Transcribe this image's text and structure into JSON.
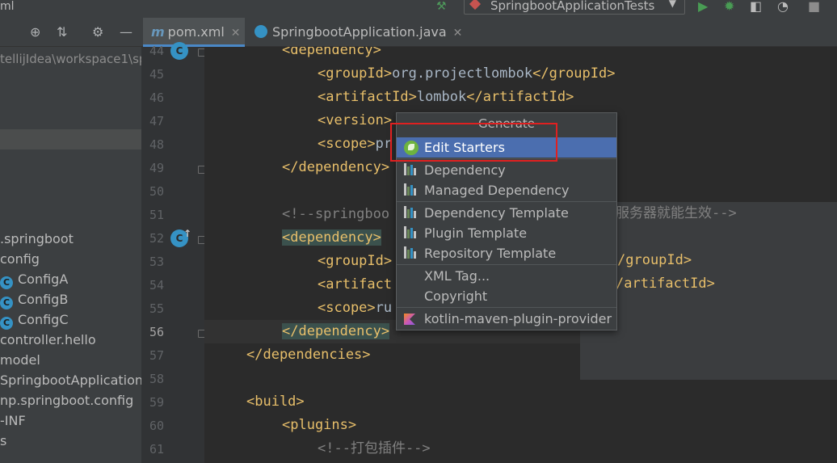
{
  "window": {
    "title_fragment": "ml"
  },
  "run_config": {
    "label": "SpringbootApplicationTests"
  },
  "project_panel": {
    "path": "tellijIdea\\workspace1\\sp",
    "items": [
      {
        "label": ".springboot",
        "icon": ""
      },
      {
        "label": "config",
        "icon": ""
      },
      {
        "label": "ConfigA",
        "icon": "class-icon"
      },
      {
        "label": "ConfigB",
        "icon": "class-icon"
      },
      {
        "label": "ConfigC",
        "icon": "class-icon"
      },
      {
        "label": "controller.hello",
        "icon": ""
      },
      {
        "label": "model",
        "icon": ""
      },
      {
        "label": "SpringbootApplication",
        "icon": ""
      },
      {
        "label": "np.springboot.config",
        "icon": ""
      },
      {
        "label": "-INF",
        "icon": ""
      },
      {
        "label": "s",
        "icon": ""
      }
    ]
  },
  "tabs": [
    {
      "label": "pom.xml",
      "active": true,
      "icon": "maven-icon"
    },
    {
      "label": "SpringbootApplication.java",
      "active": false,
      "icon": "java-class-icon"
    }
  ],
  "editor": {
    "lines": [
      {
        "num": "44",
        "indent": 2,
        "parts": [
          [
            "tag",
            "<dependency>"
          ]
        ]
      },
      {
        "num": "45",
        "indent": 3,
        "parts": [
          [
            "tag",
            "<groupId>"
          ],
          [
            "txt",
            "org.projectlombok"
          ],
          [
            "tag",
            "</groupId>"
          ]
        ]
      },
      {
        "num": "46",
        "indent": 3,
        "parts": [
          [
            "tag",
            "<artifactId>"
          ],
          [
            "txt",
            "lombok"
          ],
          [
            "tag",
            "</artifactId>"
          ]
        ]
      },
      {
        "num": "47",
        "indent": 3,
        "parts": [
          [
            "tag",
            "<version>"
          ]
        ]
      },
      {
        "num": "48",
        "indent": 3,
        "parts": [
          [
            "tag",
            "<scope>"
          ],
          [
            "txt",
            "pr"
          ]
        ]
      },
      {
        "num": "49",
        "indent": 2,
        "parts": [
          [
            "tag",
            "</dependency>"
          ]
        ]
      },
      {
        "num": "50",
        "indent": 0,
        "parts": []
      },
      {
        "num": "51",
        "indent": 2,
        "parts": [
          [
            "cmt",
            "<!--springboo"
          ]
        ]
      },
      {
        "num": "52",
        "indent": 2,
        "parts": [
          [
            "taghl",
            "<dependency>"
          ]
        ]
      },
      {
        "num": "53",
        "indent": 3,
        "parts": [
          [
            "tag",
            "<groupId>"
          ]
        ]
      },
      {
        "num": "54",
        "indent": 3,
        "parts": [
          [
            "tag",
            "<artifact"
          ]
        ]
      },
      {
        "num": "55",
        "indent": 3,
        "parts": [
          [
            "tag",
            "<scope>"
          ],
          [
            "txt",
            "ru"
          ]
        ]
      },
      {
        "num": "56",
        "indent": 2,
        "parts": [
          [
            "taghl",
            "</dependency>"
          ]
        ]
      },
      {
        "num": "57",
        "indent": 1,
        "parts": [
          [
            "tag",
            "</dependencies>"
          ]
        ]
      },
      {
        "num": "58",
        "indent": 0,
        "parts": []
      },
      {
        "num": "59",
        "indent": 1,
        "parts": [
          [
            "tag",
            "<build>"
          ]
        ]
      },
      {
        "num": "60",
        "indent": 2,
        "parts": [
          [
            "tag",
            "<plugins>"
          ]
        ]
      },
      {
        "num": "61",
        "indent": 3,
        "parts": [
          [
            "cmt",
            "<!--打包插件-->"
          ]
        ]
      }
    ],
    "right_fragments": {
      "line51": "服务器就能生效-->",
      "line53": "/groupId>",
      "line54": "/artifactId>"
    }
  },
  "popup": {
    "title": "Generate",
    "items": [
      {
        "label": "Edit Starters",
        "icon": "spring-icon",
        "selected": true
      },
      {
        "label": "Dependency",
        "icon": "maven-bars-icon"
      },
      {
        "label": "Managed Dependency",
        "icon": "maven-bars-icon"
      },
      {
        "label": "Dependency Template",
        "icon": "maven-bars-icon"
      },
      {
        "label": "Plugin Template",
        "icon": "maven-bars-icon"
      },
      {
        "label": "Repository Template",
        "icon": "maven-bars-icon"
      },
      {
        "label": "XML Tag...",
        "icon": ""
      },
      {
        "label": "Copyright",
        "icon": ""
      },
      {
        "label": "kotlin-maven-plugin-provider",
        "icon": "kotlin-icon"
      }
    ]
  },
  "colors": {
    "accent_selection": "#4b6eaf",
    "highlight_box": "#e02020",
    "tag": "#e8bf6a"
  }
}
